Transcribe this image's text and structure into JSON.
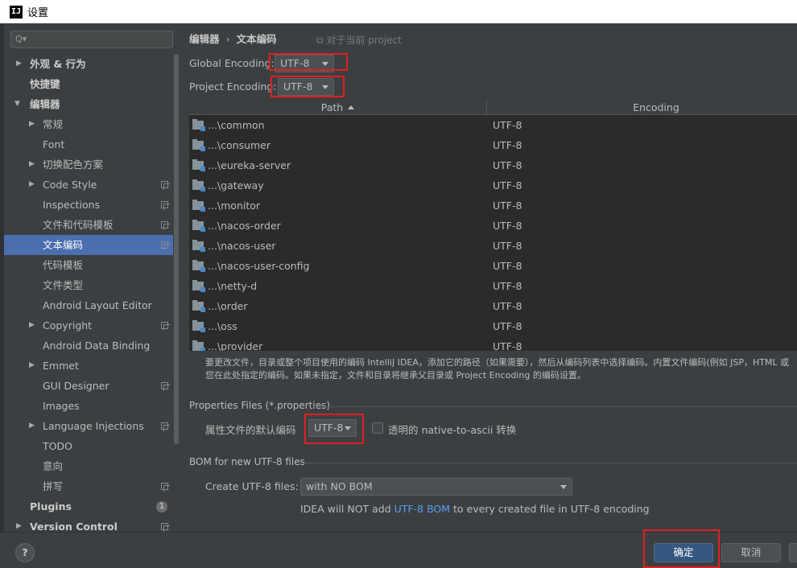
{
  "window": {
    "logo": "IJ",
    "title": "设置"
  },
  "search": {
    "placeholder": "Q▾"
  },
  "sidebar": {
    "items": [
      {
        "label": "外观 & 行为",
        "arrow": "▶"
      },
      {
        "label": "快捷键"
      },
      {
        "label": "编辑器",
        "arrow": "▼"
      },
      {
        "label": "常规",
        "arrow": "▶"
      },
      {
        "label": "Font"
      },
      {
        "label": "切换配色方案",
        "arrow": "▶"
      },
      {
        "label": "Code Style",
        "arrow": "▶"
      },
      {
        "label": "Inspections"
      },
      {
        "label": "文件和代码模板"
      },
      {
        "label": "文本编码"
      },
      {
        "label": "代码模板"
      },
      {
        "label": "文件类型"
      },
      {
        "label": "Android Layout Editor"
      },
      {
        "label": "Copyright",
        "arrow": "▶"
      },
      {
        "label": "Android Data Binding"
      },
      {
        "label": "Emmet",
        "arrow": "▶"
      },
      {
        "label": "GUI Designer"
      },
      {
        "label": "Images"
      },
      {
        "label": "Language Injections",
        "arrow": "▶"
      },
      {
        "label": "TODO"
      },
      {
        "label": "意向"
      },
      {
        "label": "拼写"
      },
      {
        "label": "Plugins",
        "badge": "1"
      },
      {
        "label": "Version Control",
        "arrow": "▶"
      }
    ]
  },
  "breadcrumb": {
    "parent": "编辑器",
    "separator": "›",
    "current": "文本编码",
    "note": "⧉ 对于当前 project"
  },
  "global_encoding": {
    "label": "Global Encoding:",
    "value": "UTF-8"
  },
  "project_encoding": {
    "label": "Project Encoding:",
    "value": "UTF-8"
  },
  "table": {
    "columns": [
      "Path",
      "Encoding"
    ],
    "rows": [
      {
        "path": "...\\common",
        "encoding": "UTF-8"
      },
      {
        "path": "...\\consumer",
        "encoding": "UTF-8"
      },
      {
        "path": "...\\eureka-server",
        "encoding": "UTF-8"
      },
      {
        "path": "...\\gateway",
        "encoding": "UTF-8"
      },
      {
        "path": "...\\monitor",
        "encoding": "UTF-8"
      },
      {
        "path": "...\\nacos-order",
        "encoding": "UTF-8"
      },
      {
        "path": "...\\nacos-user",
        "encoding": "UTF-8"
      },
      {
        "path": "...\\nacos-user-config",
        "encoding": "UTF-8"
      },
      {
        "path": "...\\netty-d",
        "encoding": "UTF-8"
      },
      {
        "path": "...\\order",
        "encoding": "UTF-8"
      },
      {
        "path": "...\\oss",
        "encoding": "UTF-8"
      },
      {
        "path": "...\\provider",
        "encoding": "UTF-8"
      }
    ]
  },
  "hint": {
    "line1": "要更改文件，目录或整个项目使用的编码 IntelliJ IDEA，添加它的路径（如果需要），然后从编码列表中选择编码。内置文件编码(例如 JSP，HTML 或",
    "line2": "您在此处指定的编码。如果未指定，文件和目录将继承父目录或 Project Encoding 的编码设置。"
  },
  "properties": {
    "section": "Properties Files (*.properties)",
    "default_label": "属性文件的默认编码",
    "default_value": "UTF-8",
    "native_label": "透明的 native-to-ascii 转换"
  },
  "bom": {
    "section": "BOM for new UTF-8 files",
    "create_label": "Create UTF-8 files:",
    "create_value": "with NO BOM",
    "info_prefix": "IDEA will NOT add ",
    "info_link": "UTF-8 BOM",
    "info_suffix": " to every created file in UTF-8 encoding"
  },
  "footer": {
    "help": "?",
    "ok": "确定",
    "cancel": "取消"
  },
  "colors": {
    "highlight": "#e02020",
    "selection": "#4b6eaf",
    "primary_button": "#365880",
    "link": "#589df6"
  }
}
